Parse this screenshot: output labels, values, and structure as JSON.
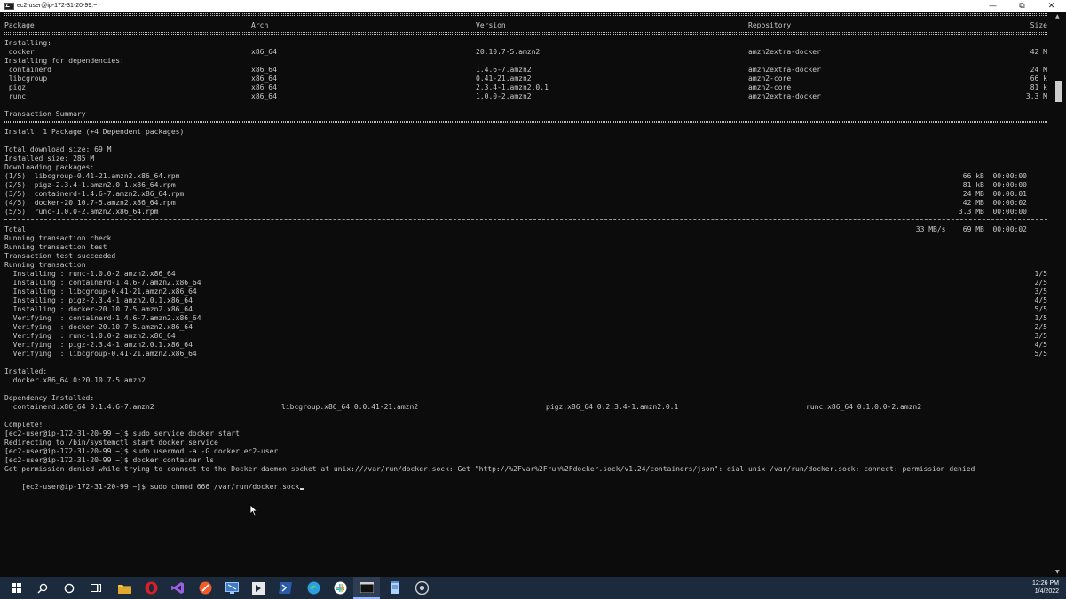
{
  "window": {
    "title": "ec2-user@ip-172-31-20-99:~",
    "minimize_glyph": "—",
    "maximize_glyph": "⧉",
    "close_glyph": "✕"
  },
  "terminal": {
    "header": {
      "package": "Package",
      "arch": "Arch",
      "version": "Version",
      "repository": "Repository",
      "size": "Size"
    },
    "section_installing": "Installing:",
    "main_package": {
      "name": " docker",
      "arch": "x86_64",
      "version": "20.10.7-5.amzn2",
      "repo": "amzn2extra-docker",
      "size": "42 M"
    },
    "section_dependencies": "Installing for dependencies:",
    "dependency_packages": [
      {
        "name": " containerd",
        "arch": "x86_64",
        "version": "1.4.6-7.amzn2",
        "repo": "amzn2extra-docker",
        "size": "24 M"
      },
      {
        "name": " libcgroup",
        "arch": "x86_64",
        "version": "0.41-21.amzn2",
        "repo": "amzn2-core",
        "size": "66 k"
      },
      {
        "name": " pigz",
        "arch": "x86_64",
        "version": "2.3.4-1.amzn2.0.1",
        "repo": "amzn2-core",
        "size": "81 k"
      },
      {
        "name": " runc",
        "arch": "x86_64",
        "version": "1.0.0-2.amzn2",
        "repo": "amzn2extra-docker",
        "size": "3.3 M"
      }
    ],
    "transaction_summary": "Transaction Summary",
    "install_summary": "Install  1 Package (+4 Dependent packages)",
    "total_download_size": "Total download size: 69 M",
    "installed_size": "Installed size: 285 M",
    "downloading_packages": "Downloading packages:",
    "downloads": [
      {
        "file": "(1/5): libcgroup-0.41-21.amzn2.x86_64.rpm",
        "stats": "|  66 kB  00:00:00"
      },
      {
        "file": "(2/5): pigz-2.3.4-1.amzn2.0.1.x86_64.rpm",
        "stats": "|  81 kB  00:00:00"
      },
      {
        "file": "(3/5): containerd-1.4.6-7.amzn2.x86_64.rpm",
        "stats": "|  24 MB  00:00:01"
      },
      {
        "file": "(4/5): docker-20.10.7-5.amzn2.x86_64.rpm",
        "stats": "|  42 MB  00:00:02"
      },
      {
        "file": "(5/5): runc-1.0.0-2.amzn2.x86_64.rpm",
        "stats": "| 3.3 MB  00:00:00"
      }
    ],
    "total": {
      "label": "Total",
      "stats": "33 MB/s |  69 MB  00:00:02"
    },
    "transaction_lines": [
      "Running transaction check",
      "Running transaction test",
      "Transaction test succeeded",
      "Running transaction"
    ],
    "steps": [
      {
        "text": "  Installing : runc-1.0.0-2.amzn2.x86_64",
        "count": "1/5"
      },
      {
        "text": "  Installing : containerd-1.4.6-7.amzn2.x86_64",
        "count": "2/5"
      },
      {
        "text": "  Installing : libcgroup-0.41-21.amzn2.x86_64",
        "count": "3/5"
      },
      {
        "text": "  Installing : pigz-2.3.4-1.amzn2.0.1.x86_64",
        "count": "4/5"
      },
      {
        "text": "  Installing : docker-20.10.7-5.amzn2.x86_64",
        "count": "5/5"
      },
      {
        "text": "  Verifying  : containerd-1.4.6-7.amzn2.x86_64",
        "count": "1/5"
      },
      {
        "text": "  Verifying  : docker-20.10.7-5.amzn2.x86_64",
        "count": "2/5"
      },
      {
        "text": "  Verifying  : runc-1.0.0-2.amzn2.x86_64",
        "count": "3/5"
      },
      {
        "text": "  Verifying  : pigz-2.3.4-1.amzn2.0.1.x86_64",
        "count": "4/5"
      },
      {
        "text": "  Verifying  : libcgroup-0.41-21.amzn2.x86_64",
        "count": "5/5"
      }
    ],
    "installed_label": "Installed:",
    "installed_value": "  docker.x86_64 0:20.10.7-5.amzn2",
    "dependency_installed_label": "Dependency Installed:",
    "dependency_installed": [
      "  containerd.x86_64 0:1.4.6-7.amzn2",
      "libcgroup.x86_64 0:0.41-21.amzn2",
      "pigz.x86_64 0:2.3.4-1.amzn2.0.1",
      "runc.x86_64 0:1.0.0-2.amzn2"
    ],
    "complete": "Complete!",
    "session": [
      "[ec2-user@ip-172-31-20-99 ~]$ sudo service docker start",
      "Redirecting to /bin/systemctl start docker.service",
      "[ec2-user@ip-172-31-20-99 ~]$ sudo usermod -a -G docker ec2-user",
      "[ec2-user@ip-172-31-20-99 ~]$ docker container ls",
      "Got permission denied while trying to connect to the Docker daemon socket at unix:///var/run/docker.sock: Get \"http://%2Fvar%2Frun%2Fdocker.sock/v1.24/containers/json\": dial unix /var/run/docker.sock: connect: permission denied"
    ],
    "current_prompt": "[ec2-user@ip-172-31-20-99 ~]$ sudo chmod 666 /var/run/docker.sock"
  },
  "taskbar": {
    "apps": [
      "windows-start-icon",
      "search-icon",
      "cortana-icon",
      "task-view-icon",
      "file-explorer-icon",
      "opera-icon",
      "visual-studio-icon",
      "git-icon",
      "remote-desktop-icon",
      "app-icon",
      "powershell-icon",
      "edge-icon",
      "slack-icon",
      "terminal-icon",
      "notepad-icon",
      "chrome-icon"
    ],
    "time": "12:26 PM",
    "date": "1/4/2022"
  }
}
